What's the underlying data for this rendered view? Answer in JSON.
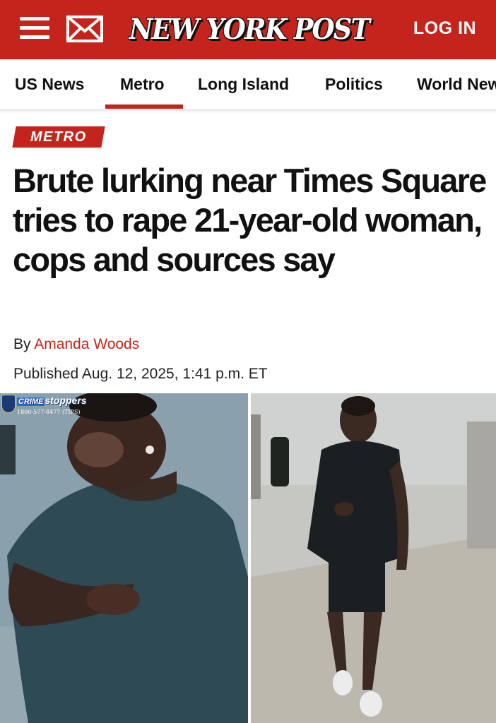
{
  "header": {
    "logo": "NEW YORK POST",
    "login_label": "LOG IN",
    "menu_icon": "hamburger-menu-icon",
    "mail_icon": "envelope-icon",
    "brand_color": "#c5241c"
  },
  "nav": {
    "items": [
      "US News",
      "Metro",
      "Long Island",
      "Politics",
      "World News"
    ],
    "active": "Metro"
  },
  "article": {
    "section": "METRO",
    "headline": "Brute lurking near Times Square tries to rape 21-year-old woman, cops and sources say",
    "byline_prefix": "By",
    "author": "Amanda Woods",
    "published": "Published Aug. 12, 2025, 1:41 p.m. ET"
  },
  "photos": {
    "left_overlay_title_a": "CRIME",
    "left_overlay_title_b": "stoppers",
    "left_overlay_phone": "1800-577-8477 (TIPS)"
  }
}
